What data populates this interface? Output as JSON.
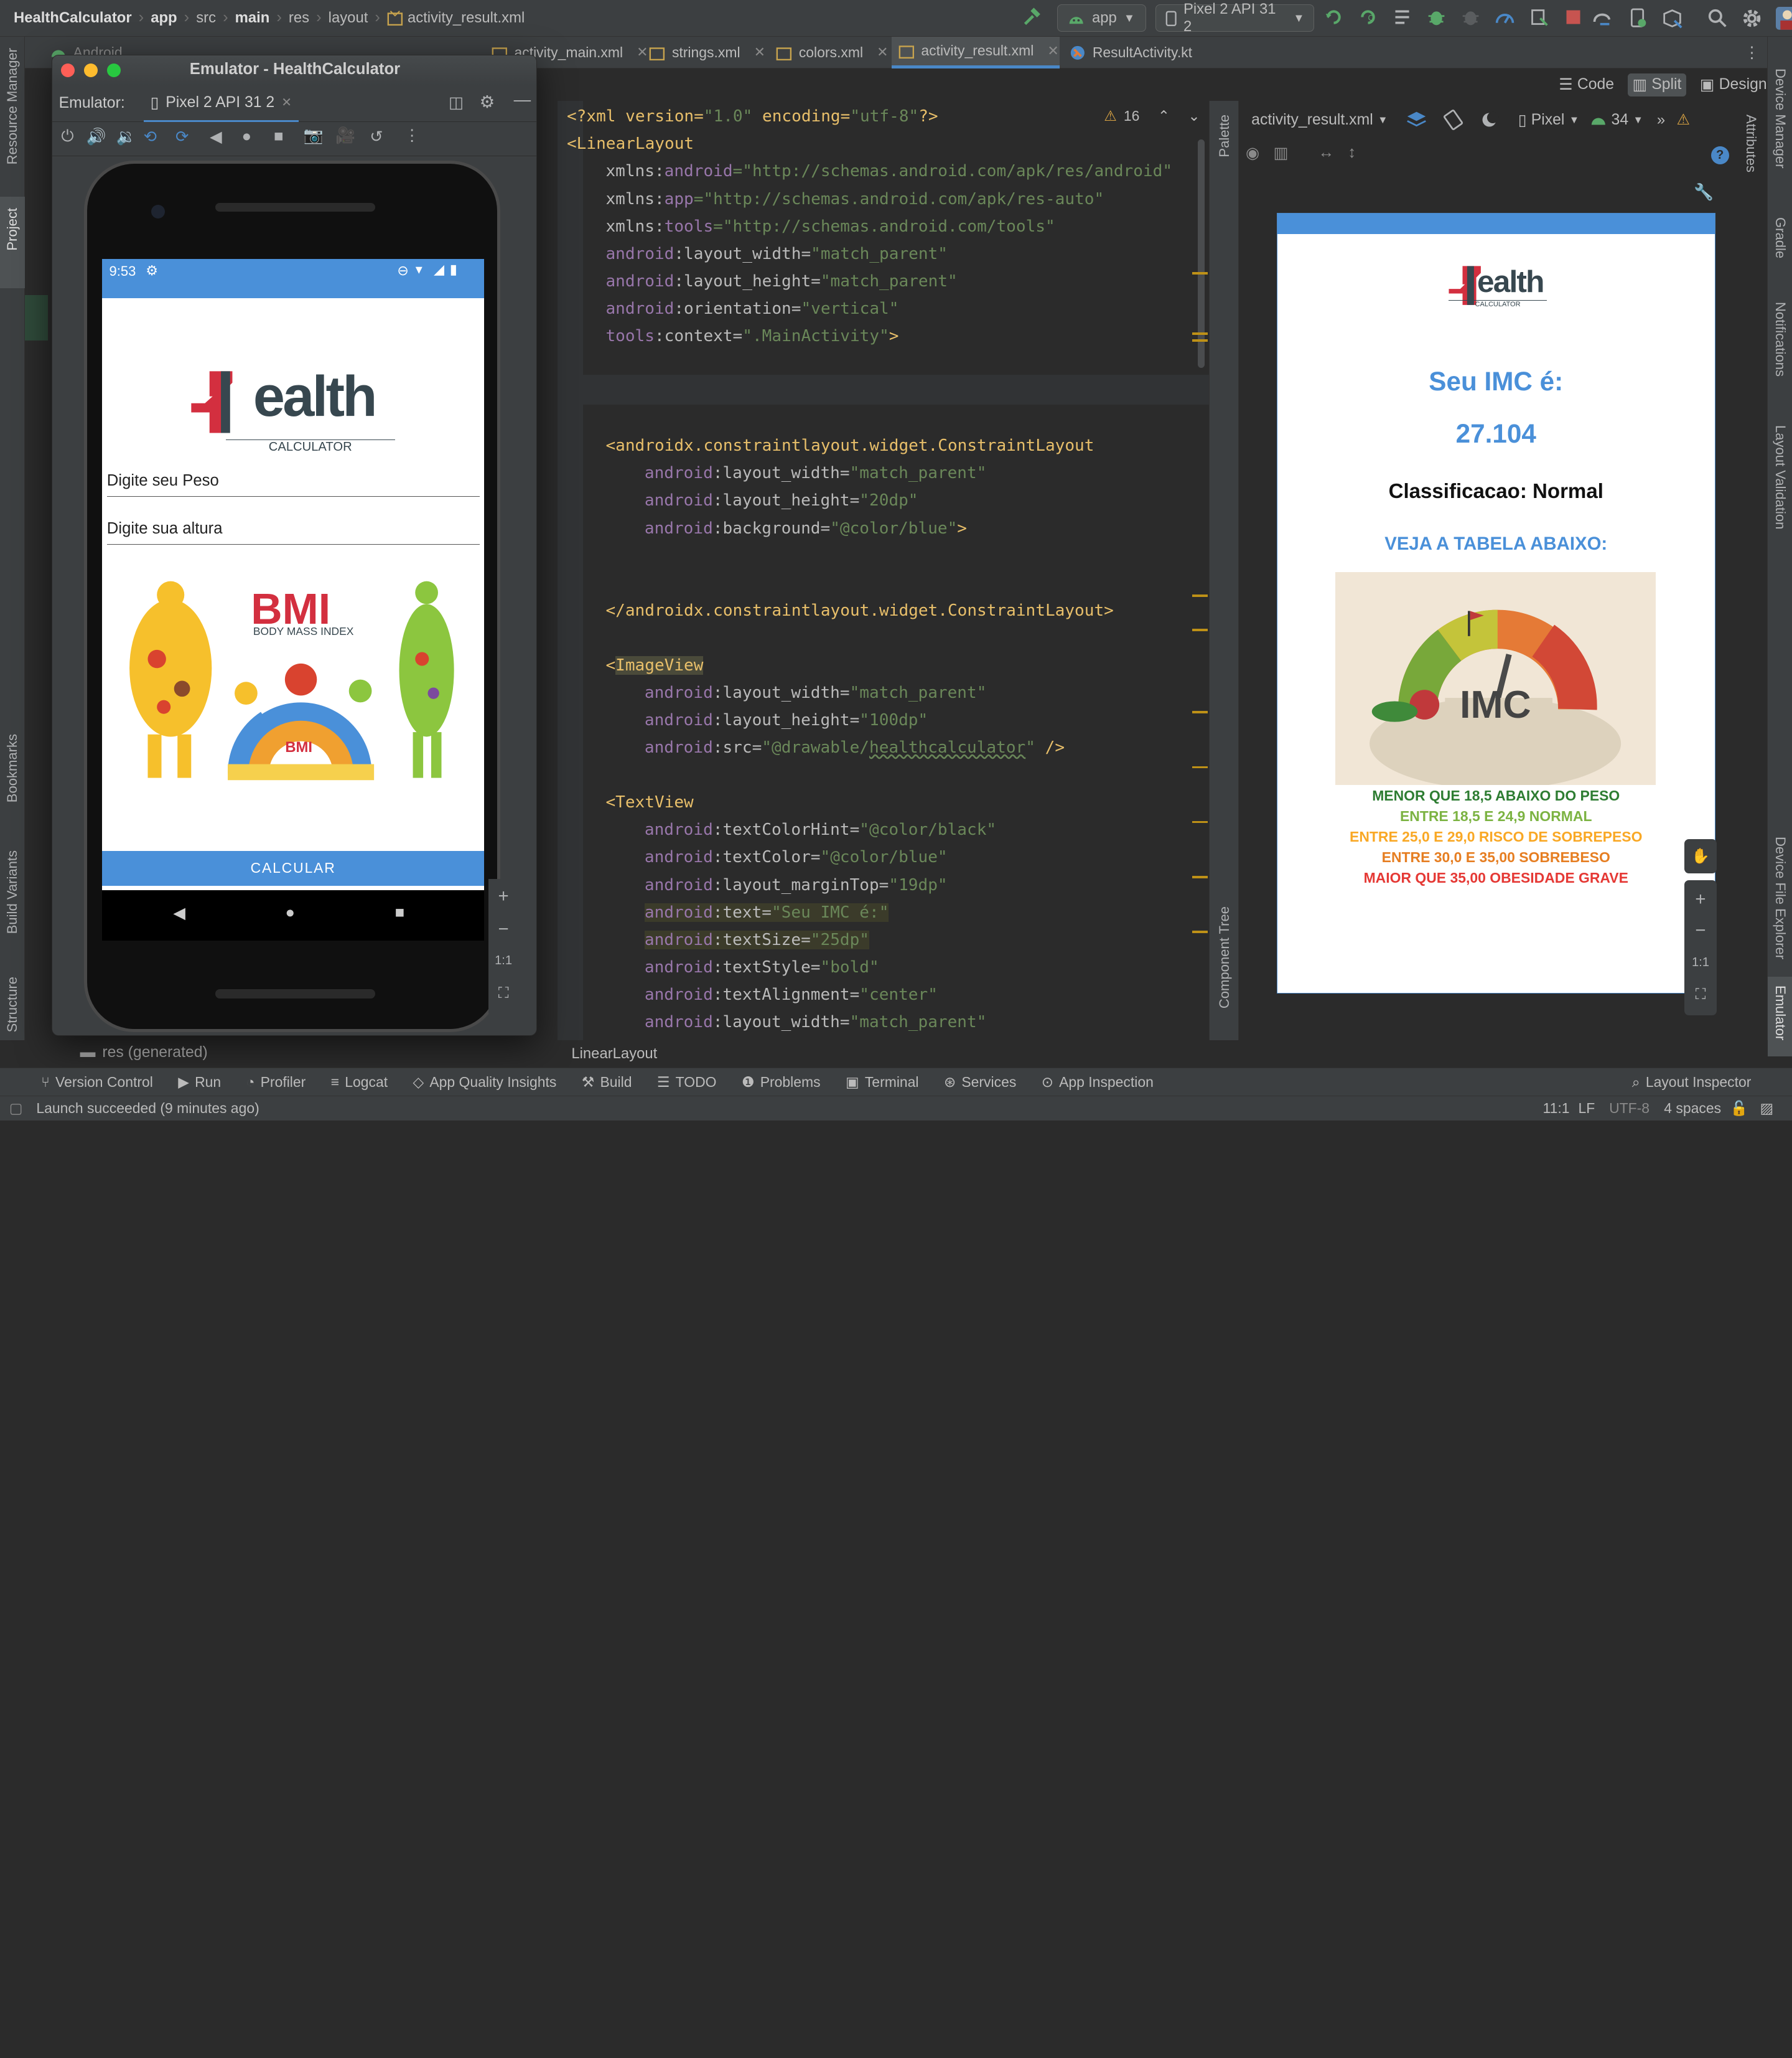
{
  "titlebar": {
    "breadcrumbs": [
      "HealthCalculator",
      "app",
      "src",
      "main",
      "res",
      "layout",
      "activity_result.xml"
    ],
    "run_config": "app",
    "device": "Pixel 2 API 31 2"
  },
  "tabs": [
    {
      "label": "activity_main.xml"
    },
    {
      "label": "strings.xml"
    },
    {
      "label": "colors.xml"
    },
    {
      "label": "activity_result.xml"
    },
    {
      "label": "ResultActivity.kt"
    }
  ],
  "project_panel": {
    "dropdown": "Android",
    "generated_item": "res (generated)"
  },
  "left_stripe": {
    "resource_manager": "Resource Manager",
    "project": "Project",
    "bookmarks": "Bookmarks",
    "build_variants": "Build Variants",
    "structure": "Structure"
  },
  "right_stripe": {
    "device_manager": "Device Manager",
    "gradle": "Gradle",
    "notifications": "Notifications",
    "layout_validation": "Layout Validation",
    "device_file_explorer": "Device File Explorer",
    "emulator": "Emulator"
  },
  "view_modes": {
    "code": "Code",
    "split": "Split",
    "design": "Design"
  },
  "inspection": {
    "warnings": "16"
  },
  "code": {
    "line1_a": "<?xml version=",
    "line1_b": "\"1.0\"",
    "line1_c": " encoding=",
    "line1_d": "\"utf-8\"",
    "line1_e": "?>",
    "linear_layout_open": "<LinearLayout",
    "xmlns_android_ns": "xmlns:",
    "xmlns_android_attr": "android",
    "xmlns_android_val": "=\"http://schemas.android.com/apk/res/android\"",
    "xmlns_app_attr": "app",
    "xmlns_app_val": "=\"http://schemas.android.com/apk/res-auto\"",
    "xmlns_tools_attr": "tools",
    "xmlns_tools_val": "=\"http://schemas.android.com/tools\"",
    "android_ns": "android",
    "tools_ns": "tools",
    "layout_width": ":layout_width=",
    "layout_height": ":layout_height=",
    "orientation": ":orientation=",
    "context": ":context=",
    "match_parent": "\"match_parent\"",
    "vertical": "\"vertical\"",
    "main_activity": "\".MainActivity\"",
    "close_bracket": ">",
    "constraint_open": "<androidx.constraintlayout.widget.ConstraintLayout",
    "h_20dp": "\"20dp\"",
    "background": ":background=",
    "color_blue": "\"@color/blue\"",
    "constraint_close": "</androidx.constraintlayout.widget.ConstraintLayout>",
    "imageview_bracket": "<",
    "imageview_name": "ImageView",
    "h_100dp": "\"100dp\"",
    "src": ":src=",
    "src_q": "\"@drawable/",
    "src_name": "healthcalculator",
    "src_end": "\"",
    "self_close": " />",
    "textview_open": "<TextView",
    "text_color_hint": ":textColorHint=",
    "color_black": "\"@color/black\"",
    "text_color": ":textColor=",
    "margin_top": ":layout_marginTop=",
    "v_19dp": "\"19dp\"",
    "text": ":text=",
    "seu_imc": "\"Seu IMC é:\"",
    "text_size": ":textSize=",
    "v_25dp": "\"25dp\"",
    "text_style": ":textStyle=",
    "bold": "\"bold\"",
    "text_alignment": ":textAlignment=",
    "center": "\"center\""
  },
  "preview": {
    "file_dropdown": "activity_result.xml",
    "device": "Pixel",
    "api": "34",
    "logo_word": "ealth",
    "logo_sub": "CALCULATOR",
    "imc_title": "Seu IMC é:",
    "imc_value": "27.104",
    "classification": "Classificacao: Normal",
    "see_table": "VEJA A TABELA ABAIXO:",
    "image_label": "IMC",
    "table": [
      {
        "text": "MENOR QUE 18,5 ABAIXO DO PESO",
        "color": "#2e7d32"
      },
      {
        "text": "ENTRE 18,5 E 24,9 NORMAL",
        "color": "#7cb342"
      },
      {
        "text": "ENTRE 25,0 E 29,0 RISCO DE SOBREPESO",
        "color": "#f9a825"
      },
      {
        "text": "ENTRE 30,0 E 35,00 SOBREBESO",
        "color": "#e67e22"
      },
      {
        "text": "MAIOR QUE 35,00 OBESIDADE GRAVE",
        "color": "#e53935"
      }
    ],
    "zoom_ratio": "1:1"
  },
  "panels": {
    "palette": "Palette",
    "component_tree": "Component Tree",
    "attributes": "Attributes"
  },
  "emulator": {
    "title": "Emulator - HealthCalculator",
    "label": "Emulator:",
    "device_tab": "Pixel 2 API 31 2",
    "zoom_ratio": "1:1",
    "phone": {
      "time": "9:53",
      "logo_word": "ealth",
      "logo_sub": "CALCULATOR",
      "weight_hint": "Digite seu Peso",
      "height_hint": "Digite sua altura",
      "bmi_title": "BMI",
      "bmi_sub": "BODY MASS INDEX",
      "gauge_label": "BMI",
      "button": "CALCULAR"
    }
  },
  "editor_breadcrumb": "LinearLayout",
  "bottom_tabs": [
    "Version Control",
    "Run",
    "Profiler",
    "Logcat",
    "App Quality Insights",
    "Build",
    "TODO",
    "Problems",
    "Terminal",
    "Services",
    "App Inspection"
  ],
  "layout_inspector": "Layout Inspector",
  "status": {
    "message": "Launch succeeded (9 minutes ago)",
    "position": "11:1",
    "line_sep": "LF",
    "encoding": "UTF-8",
    "indent": "4 spaces"
  },
  "colors": {
    "accent_blue": "#4a90d9",
    "phone_blue": "#4a90d9",
    "health_red": "#d32f3f",
    "editor_bg": "#2b2b2b",
    "panel_bg": "#3c3f41"
  }
}
